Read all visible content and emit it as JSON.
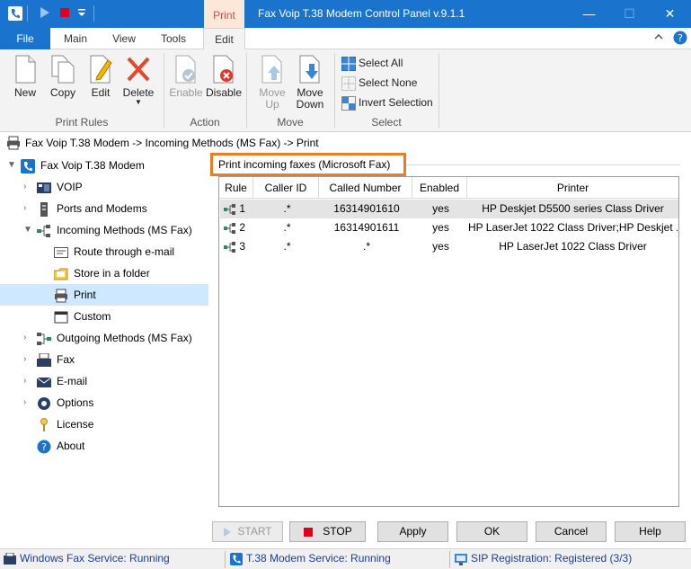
{
  "titlebar": {
    "context_tab": "Print",
    "title": "Fax Voip T.38 Modem Control Panel v.9.1.1",
    "minimize_glyph": "—",
    "maximize_glyph": "☐",
    "close_glyph": "✕"
  },
  "tabs": {
    "file": "File",
    "main": "Main",
    "view": "View",
    "tools": "Tools",
    "edit": "Edit"
  },
  "ribbon": {
    "print_rules": {
      "label": "Print Rules",
      "new": "New",
      "copy": "Copy",
      "edit": "Edit",
      "delete": "Delete"
    },
    "action": {
      "label": "Action",
      "enable": "Enable",
      "disable": "Disable"
    },
    "move": {
      "label": "Move",
      "move_up_1": "Move",
      "move_up_2": "Up",
      "move_down_1": "Move",
      "move_down_2": "Down"
    },
    "select": {
      "label": "Select",
      "select_all": "Select All",
      "select_none": "Select None",
      "invert": "Invert Selection"
    }
  },
  "breadcrumb": "Fax Voip T.38 Modem -> Incoming Methods (MS Fax) -> Print",
  "tree": {
    "root": "Fax Voip T.38 Modem",
    "voip": "VOIP",
    "ports": "Ports and Modems",
    "incoming": "Incoming Methods (MS Fax)",
    "route_email": "Route through e-mail",
    "store_folder": "Store in a folder",
    "print": "Print",
    "custom": "Custom",
    "outgoing": "Outgoing Methods (MS Fax)",
    "fax": "Fax",
    "email": "E-mail",
    "options": "Options",
    "license": "License",
    "about": "About"
  },
  "panel": {
    "title": "Print incoming faxes (Microsoft Fax)",
    "columns": [
      "Rule",
      "Caller ID",
      "Called Number",
      "Enabled",
      "Printer"
    ],
    "rows": [
      {
        "rule": "1",
        "caller": ".*",
        "called": "16314901610",
        "enabled": "yes",
        "printer": "HP Deskjet D5500 series Class Driver"
      },
      {
        "rule": "2",
        "caller": ".*",
        "called": "16314901611",
        "enabled": "yes",
        "printer": "HP LaserJet 1022 Class Driver;HP Deskjet ..."
      },
      {
        "rule": "3",
        "caller": ".*",
        "called": ".*",
        "enabled": "yes",
        "printer": "HP LaserJet 1022 Class Driver"
      }
    ]
  },
  "buttons": {
    "start": "START",
    "stop": "STOP",
    "apply": "Apply",
    "ok": "OK",
    "cancel": "Cancel",
    "help": "Help"
  },
  "status": {
    "fax_service": "Windows Fax Service: Running",
    "modem_service": "T.38 Modem Service: Running",
    "sip": "SIP Registration: Registered (3/3)"
  },
  "colors": {
    "accent": "#1a73cc",
    "highlight": "#f07b22",
    "tree_selected": "#cde8ff"
  }
}
